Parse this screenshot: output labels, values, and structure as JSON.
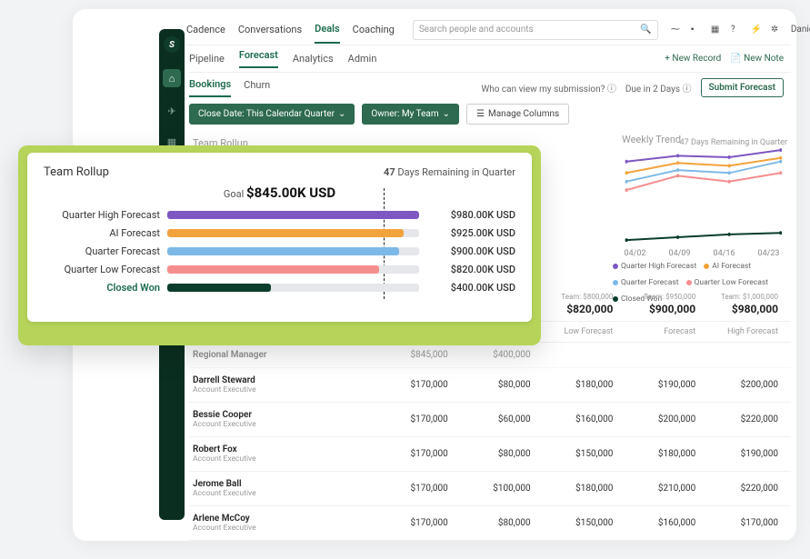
{
  "nav": {
    "primary": [
      "Cadence",
      "Conversations",
      "Deals",
      "Coaching"
    ],
    "primary_active": "Deals",
    "search_placeholder": "Search people and accounts",
    "user_name": "Daniel",
    "sub": [
      "Pipeline",
      "Forecast",
      "Analytics",
      "Admin"
    ],
    "sub_active": "Forecast",
    "new_record": "+ New Record",
    "new_note": "New Note",
    "tertiary": [
      "Bookings",
      "Churn"
    ],
    "tertiary_active": "Bookings",
    "view_q": "Who can view my submission?",
    "due": "Due in 2 Days",
    "submit": "Submit Forecast"
  },
  "filters": {
    "close_date": "Close Date: This Calendar Quarter",
    "owner": "Owner: My Team",
    "manage": "Manage Columns"
  },
  "ghost": {
    "title": "Team Rollup",
    "days": "47 Days Remaining in Quarter",
    "weekly": "Weekly Trend"
  },
  "rollup_card": {
    "title": "Team Rollup",
    "days_num": "47",
    "days_text": " Days Remaining in Quarter",
    "goal_label": "Goal ",
    "goal_value": "$845.00K USD",
    "rows": [
      {
        "label": "Quarter High Forecast",
        "value": "$980.00K USD",
        "pct": 100,
        "color": "#7e57c2"
      },
      {
        "label": "AI Forecast",
        "value": "$925.00K USD",
        "pct": 94,
        "color": "#f2a33c"
      },
      {
        "label": "Quarter Forecast",
        "value": "$900.00K USD",
        "pct": 92,
        "color": "#7db9e8"
      },
      {
        "label": "Quarter Low Forecast",
        "value": "$820.00K USD",
        "pct": 84,
        "color": "#f68d8d"
      },
      {
        "label": "Closed Won",
        "value": "$400.00K USD",
        "pct": 41,
        "color": "#0a3d2a"
      }
    ],
    "goal_line_pct": 86
  },
  "chart_data": {
    "type": "line",
    "x": [
      "04/02",
      "04/09",
      "04/16",
      "04/23"
    ],
    "series": [
      {
        "name": "Quarter High Forecast",
        "color": "#7e57c2",
        "values": [
          900,
          940,
          930,
          980
        ]
      },
      {
        "name": "AI Forecast",
        "color": "#f2a33c",
        "values": [
          820,
          890,
          870,
          925
        ]
      },
      {
        "name": "Quarter Forecast",
        "color": "#7db9e8",
        "values": [
          760,
          840,
          820,
          900
        ]
      },
      {
        "name": "Quarter Low Forecast",
        "color": "#f68d8d",
        "values": [
          700,
          800,
          760,
          820
        ]
      },
      {
        "name": "Closed Won",
        "color": "#0a3d2a",
        "values": [
          350,
          370,
          390,
          400
        ]
      }
    ],
    "ylim": [
      300,
      1000
    ]
  },
  "table": {
    "headers": {
      "low": "Low Forecast",
      "low_team": "Team: $800,000",
      "low_val": "$820,000",
      "fc": "Forecast",
      "fc_team": "Team: $950,000",
      "fc_val": "$900,000",
      "high": "High Forecast",
      "high_team": "Team: $1,000,000",
      "high_val": "$980,000"
    },
    "ghost_row": {
      "name": "Regional Manager",
      "c1": "$845,000",
      "c2": "$400,000"
    },
    "rows": [
      {
        "name": "Darrell Steward",
        "role": "Account Executive",
        "c1": "$170,000",
        "c2": "$80,000",
        "c3": "$180,000",
        "c4": "$190,000",
        "c5": "$200,000"
      },
      {
        "name": "Bessie Cooper",
        "role": "Account Executive",
        "c1": "$170,000",
        "c2": "$60,000",
        "c3": "$160,000",
        "c4": "$200,000",
        "c5": "$220,000"
      },
      {
        "name": "Robert Fox",
        "role": "Account Executive",
        "c1": "$170,000",
        "c2": "$80,000",
        "c3": "$150,000",
        "c4": "$180,000",
        "c5": "$190,000"
      },
      {
        "name": "Jerome Ball",
        "role": "Account Executive",
        "c1": "$170,000",
        "c2": "$100,000",
        "c3": "$180,000",
        "c4": "$210,000",
        "c5": "$220,000"
      },
      {
        "name": "Arlene McCoy",
        "role": "Account Executive",
        "c1": "$170,000",
        "c2": "$80,000",
        "c3": "$150,000",
        "c4": "$160,000",
        "c5": "$170,000"
      }
    ]
  }
}
